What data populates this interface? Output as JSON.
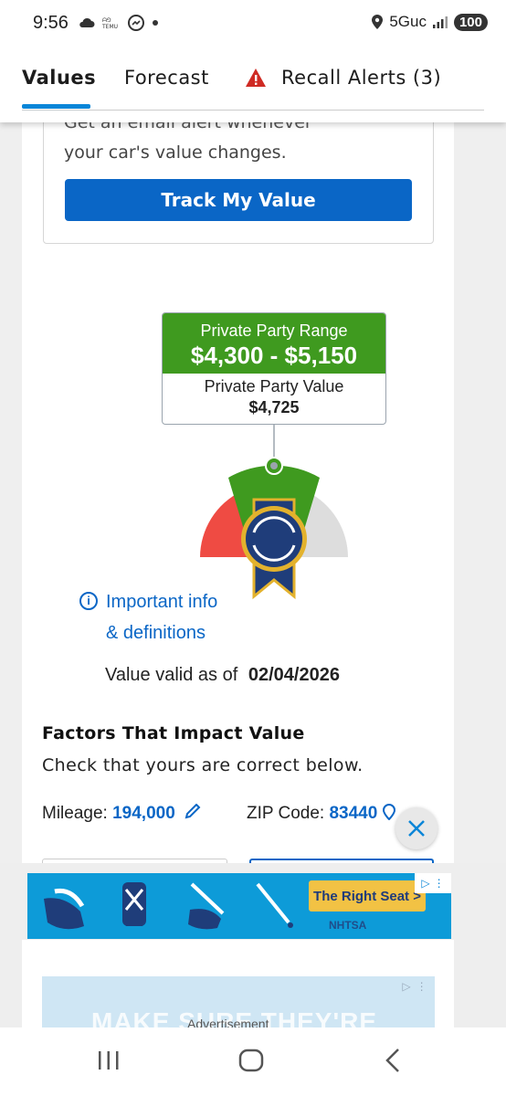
{
  "status_bar": {
    "time": "9:56",
    "network": "5Guc",
    "battery": "100"
  },
  "tabs": [
    {
      "label": "Values",
      "active": true
    },
    {
      "label": "Forecast",
      "active": false
    },
    {
      "label": "Recall Alerts (3)",
      "active": false
    }
  ],
  "email_alert": {
    "text_partial": "Get an email alert whenever",
    "text": "your car's value changes.",
    "button_label": "Track My Value"
  },
  "valuation": {
    "range_label": "Private Party Range",
    "range_value": "$4,300 - $5,150",
    "value_label": "Private Party Value",
    "value": "$4,725"
  },
  "info_link": {
    "line1": "Important info",
    "line2": "& definitions"
  },
  "valid_date": {
    "label": "Value valid as of",
    "date": "02/04/2026"
  },
  "factors": {
    "title": "Factors That Impact Value",
    "subtitle": "Check that yours are correct below.",
    "mileage_label": "Mileage:",
    "mileage_value": "194,000",
    "zip_label": "ZIP Code:",
    "zip_value": "83440"
  },
  "ads": {
    "banner_cta": "The Right Seat >",
    "banner_brand": "NHTSA",
    "second_ad_text": "MAKE SURE THEY'RE",
    "label": "Advertisement"
  },
  "colors": {
    "accent": "#0a66c6",
    "range_green": "#3f9a1f",
    "gauge_red": "#ef4b43",
    "gauge_gray": "#dddddd",
    "badge_navy": "#1f3d7a"
  }
}
